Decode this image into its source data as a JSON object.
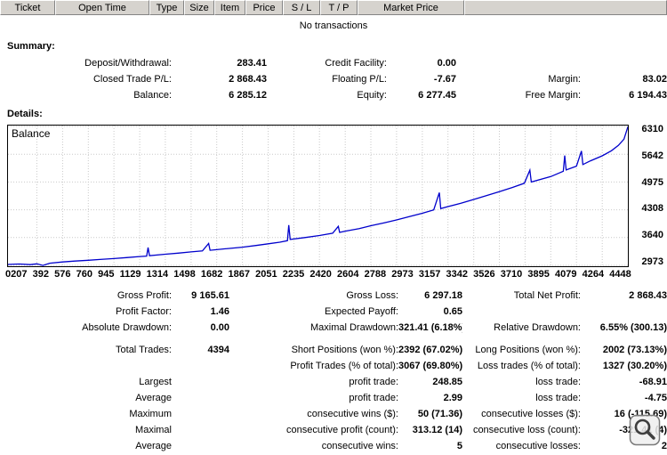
{
  "table_header": {
    "columns": [
      "Ticket",
      "Open Time",
      "Type",
      "Size",
      "Item",
      "Price",
      "S / L",
      "T / P",
      "Market Price"
    ]
  },
  "no_transactions": "No transactions",
  "summary": {
    "title": "Summary:",
    "rows": [
      [
        "Deposit/Withdrawal:",
        "283.41",
        "Credit Facility:",
        "0.00",
        "",
        ""
      ],
      [
        "Closed Trade P/L:",
        "2 868.43",
        "Floating P/L:",
        "-7.67",
        "Margin:",
        "83.02"
      ],
      [
        "Balance:",
        "6 285.12",
        "Equity:",
        "6 277.45",
        "Free Margin:",
        "6 194.43"
      ]
    ]
  },
  "details": {
    "title": "Details:"
  },
  "chart_data": {
    "type": "line",
    "title": "Balance",
    "line_color": "#0000cc",
    "grid_color": "#c9c9c9",
    "x_range": [
      0,
      4448
    ],
    "y_range": [
      2973,
      6310
    ],
    "y_ticks": [
      6310,
      5642,
      4975,
      4308,
      3640,
      2973
    ],
    "x_tick_labels": [
      "0207",
      "392",
      "576",
      "760",
      "945",
      "1129",
      "1314",
      "1498",
      "1682",
      "1867",
      "2051",
      "2235",
      "2420",
      "2604",
      "2788",
      "2973",
      "3157",
      "3342",
      "3526",
      "3710",
      "3895",
      "4079",
      "4264",
      "4448"
    ],
    "points": [
      [
        0,
        2995
      ],
      [
        80,
        3005
      ],
      [
        160,
        2990
      ],
      [
        207,
        3010
      ],
      [
        250,
        2970
      ],
      [
        300,
        3025
      ],
      [
        392,
        3055
      ],
      [
        480,
        3075
      ],
      [
        576,
        3095
      ],
      [
        660,
        3115
      ],
      [
        760,
        3135
      ],
      [
        850,
        3160
      ],
      [
        945,
        3185
      ],
      [
        995,
        3195
      ],
      [
        1005,
        3400
      ],
      [
        1015,
        3205
      ],
      [
        1129,
        3240
      ],
      [
        1220,
        3265
      ],
      [
        1314,
        3295
      ],
      [
        1395,
        3320
      ],
      [
        1440,
        3500
      ],
      [
        1450,
        3335
      ],
      [
        1560,
        3370
      ],
      [
        1682,
        3410
      ],
      [
        1780,
        3450
      ],
      [
        1867,
        3490
      ],
      [
        1950,
        3530
      ],
      [
        2005,
        3565
      ],
      [
        2015,
        3940
      ],
      [
        2025,
        3595
      ],
      [
        2130,
        3640
      ],
      [
        2235,
        3690
      ],
      [
        2330,
        3745
      ],
      [
        2370,
        3910
      ],
      [
        2380,
        3765
      ],
      [
        2420,
        3795
      ],
      [
        2520,
        3855
      ],
      [
        2604,
        3925
      ],
      [
        2700,
        3995
      ],
      [
        2788,
        4065
      ],
      [
        2880,
        4145
      ],
      [
        2973,
        4225
      ],
      [
        3055,
        4305
      ],
      [
        3095,
        4720
      ],
      [
        3105,
        4335
      ],
      [
        3157,
        4385
      ],
      [
        3250,
        4465
      ],
      [
        3342,
        4555
      ],
      [
        3440,
        4655
      ],
      [
        3526,
        4745
      ],
      [
        3620,
        4845
      ],
      [
        3705,
        4945
      ],
      [
        3745,
        5260
      ],
      [
        3755,
        4975
      ],
      [
        3895,
        5105
      ],
      [
        3985,
        5235
      ],
      [
        3995,
        5610
      ],
      [
        4005,
        5265
      ],
      [
        4079,
        5355
      ],
      [
        4115,
        5720
      ],
      [
        4125,
        5395
      ],
      [
        4180,
        5485
      ],
      [
        4264,
        5605
      ],
      [
        4330,
        5725
      ],
      [
        4380,
        5855
      ],
      [
        4420,
        6005
      ],
      [
        4448,
        6300
      ]
    ]
  },
  "stats": {
    "rows_top": [
      [
        "Gross Profit:",
        "9 165.61",
        "Gross Loss:",
        "6 297.18",
        "Total Net Profit:",
        "2 868.43"
      ],
      [
        "Profit Factor:",
        "1.46",
        "Expected Payoff:",
        "0.65",
        "",
        ""
      ],
      [
        "Absolute Drawdown:",
        "0.00",
        "Maximal Drawdown:",
        "321.41 (6.18%)",
        "Relative Drawdown:",
        "6.55% (300.13)"
      ]
    ],
    "rows_main": [
      [
        "Total Trades:",
        "4394",
        "Short Positions (won %):",
        "2392 (67.02%)",
        "Long Positions (won %):",
        "2002 (73.13%)"
      ],
      [
        "",
        "",
        "Profit Trades (% of total):",
        "3067 (69.80%)",
        "Loss trades (% of total):",
        "1327 (30.20%)"
      ],
      [
        "Largest",
        "",
        "profit trade:",
        "248.85",
        "loss trade:",
        "-68.91"
      ],
      [
        "Average",
        "",
        "profit trade:",
        "2.99",
        "loss trade:",
        "-4.75"
      ],
      [
        "Maximum",
        "",
        "consecutive wins ($):",
        "50 (71.36)",
        "consecutive losses ($):",
        "16 (-115.69)"
      ],
      [
        "Maximal",
        "",
        "consecutive profit (count):",
        "313.12 (14)",
        "consecutive loss (count):",
        "-321.41 (4)"
      ],
      [
        "Average",
        "",
        "consecutive wins:",
        "5",
        "consecutive losses:",
        "2"
      ]
    ]
  }
}
